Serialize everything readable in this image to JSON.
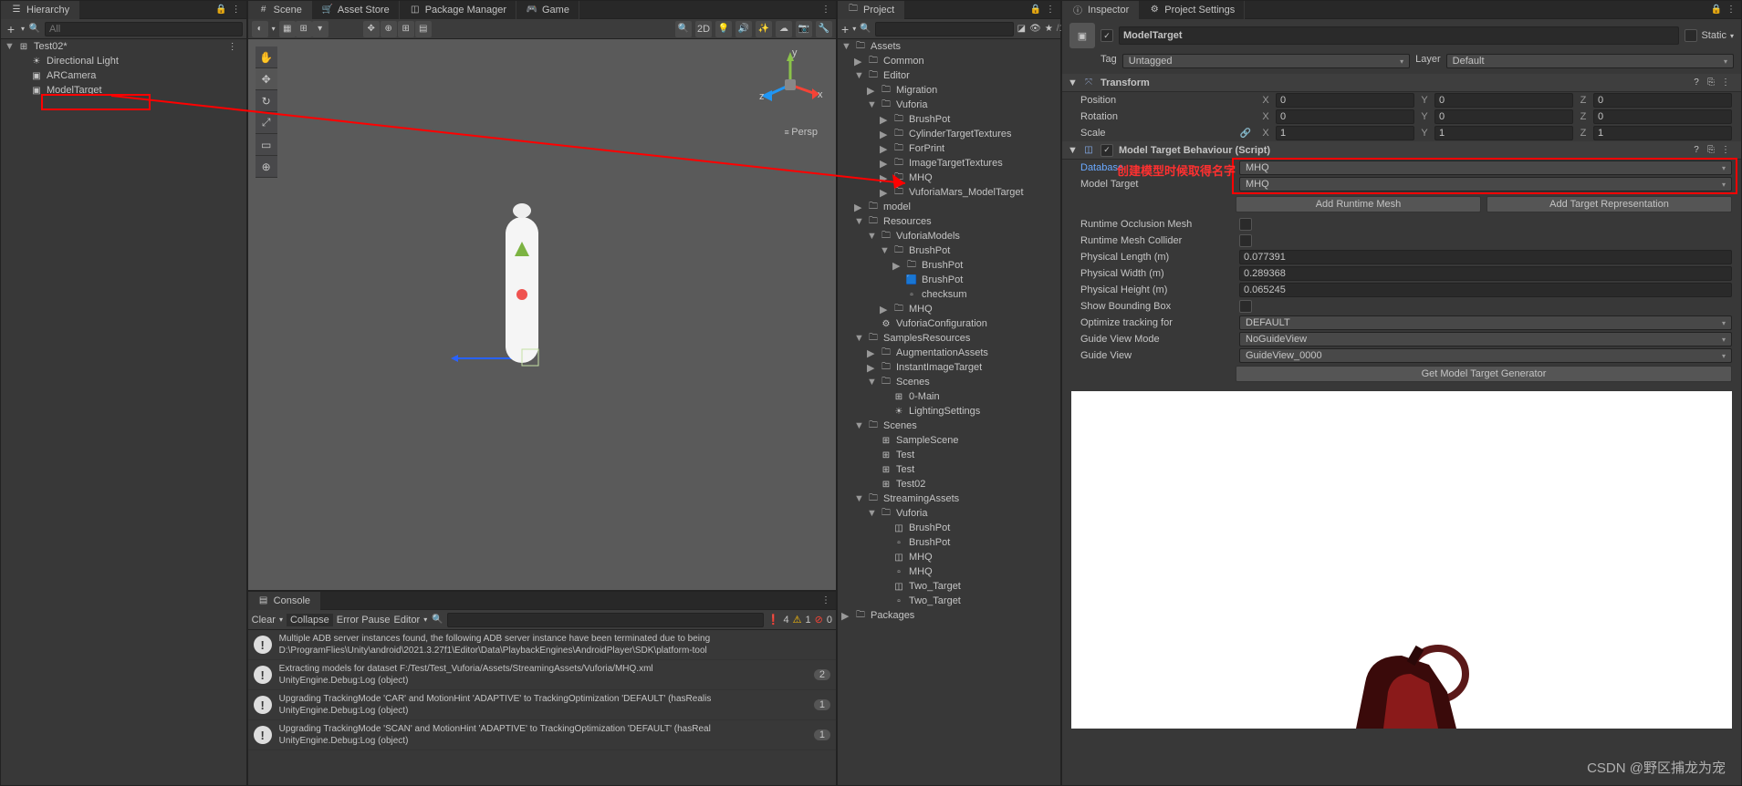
{
  "watermark": "CSDN @野区捕龙为宠",
  "hierarchy": {
    "tab": "Hierarchy",
    "searchPlaceholder": "All",
    "scene": "Test02*",
    "items": [
      "Directional Light",
      "ARCamera",
      "ModelTarget"
    ]
  },
  "sceneTabs": [
    "Scene",
    "Asset Store",
    "Package Manager",
    "Game"
  ],
  "sceneOverlay": {
    "persp": "Persp",
    "shading": "2D"
  },
  "console": {
    "tab": "Console",
    "buttons": {
      "clear": "Clear",
      "collapse": "Collapse",
      "errorPause": "Error Pause",
      "editor": "Editor"
    },
    "counts": {
      "info": "4",
      "warn": "1",
      "err": "0"
    },
    "entries": [
      {
        "type": "info",
        "count": "",
        "l1": "Multiple ADB server instances found, the following ADB server instance have been terminated due to being",
        "l2": "D:\\ProgramFlies\\Unity\\android\\2021.3.27f1\\Editor\\Data\\PlaybackEngines\\AndroidPlayer\\SDK\\platform-tool"
      },
      {
        "type": "info",
        "count": "2",
        "l1": "Extracting models for dataset F:/Test/Test_Vuforia/Assets/StreamingAssets/Vuforia/MHQ.xml",
        "l2": "UnityEngine.Debug:Log (object)"
      },
      {
        "type": "info",
        "count": "1",
        "l1": "Upgrading TrackingMode 'CAR' and MotionHint 'ADAPTIVE' to TrackingOptimization 'DEFAULT' (hasRealis",
        "l2": "UnityEngine.Debug:Log (object)"
      },
      {
        "type": "info",
        "count": "1",
        "l1": "Upgrading TrackingMode 'SCAN' and MotionHint 'ADAPTIVE' to TrackingOptimization 'DEFAULT' (hasReal",
        "l2": "UnityEngine.Debug:Log (object)"
      }
    ]
  },
  "project": {
    "tab": "Project",
    "tree": [
      {
        "d": 0,
        "a": "▼",
        "i": "folder",
        "t": "Assets"
      },
      {
        "d": 1,
        "a": "▶",
        "i": "folder",
        "t": "Common"
      },
      {
        "d": 1,
        "a": "▼",
        "i": "folder",
        "t": "Editor"
      },
      {
        "d": 2,
        "a": "▶",
        "i": "folder",
        "t": "Migration"
      },
      {
        "d": 2,
        "a": "▼",
        "i": "folder",
        "t": "Vuforia"
      },
      {
        "d": 3,
        "a": "▶",
        "i": "folder",
        "t": "BrushPot"
      },
      {
        "d": 3,
        "a": "▶",
        "i": "folder",
        "t": "CylinderTargetTextures"
      },
      {
        "d": 3,
        "a": "▶",
        "i": "folder",
        "t": "ForPrint"
      },
      {
        "d": 3,
        "a": "▶",
        "i": "folder",
        "t": "ImageTargetTextures"
      },
      {
        "d": 3,
        "a": "▶",
        "i": "folder",
        "t": "MHQ"
      },
      {
        "d": 3,
        "a": "▶",
        "i": "folder",
        "t": "VuforiaMars_ModelTarget"
      },
      {
        "d": 1,
        "a": "▶",
        "i": "folder",
        "t": "model"
      },
      {
        "d": 1,
        "a": "▼",
        "i": "folder",
        "t": "Resources"
      },
      {
        "d": 2,
        "a": "▼",
        "i": "folder",
        "t": "VuforiaModels"
      },
      {
        "d": 3,
        "a": "▼",
        "i": "folder",
        "t": "BrushPot"
      },
      {
        "d": 4,
        "a": "▶",
        "i": "folder",
        "t": "BrushPot"
      },
      {
        "d": 4,
        "a": "",
        "i": "prefab",
        "t": "BrushPot"
      },
      {
        "d": 4,
        "a": "",
        "i": "file",
        "t": "checksum"
      },
      {
        "d": 3,
        "a": "▶",
        "i": "folder",
        "t": "MHQ"
      },
      {
        "d": 2,
        "a": "",
        "i": "asset",
        "t": "VuforiaConfiguration"
      },
      {
        "d": 1,
        "a": "▼",
        "i": "folder",
        "t": "SamplesResources"
      },
      {
        "d": 2,
        "a": "▶",
        "i": "folder",
        "t": "AugmentationAssets"
      },
      {
        "d": 2,
        "a": "▶",
        "i": "folder",
        "t": "InstantImageTarget"
      },
      {
        "d": 2,
        "a": "▼",
        "i": "folder",
        "t": "Scenes"
      },
      {
        "d": 3,
        "a": "",
        "i": "scene",
        "t": "0-Main"
      },
      {
        "d": 3,
        "a": "",
        "i": "light",
        "t": "LightingSettings"
      },
      {
        "d": 1,
        "a": "▼",
        "i": "folder",
        "t": "Scenes"
      },
      {
        "d": 2,
        "a": "",
        "i": "scene",
        "t": "SampleScene"
      },
      {
        "d": 2,
        "a": "",
        "i": "scene",
        "t": "Test"
      },
      {
        "d": 2,
        "a": "",
        "i": "scene",
        "t": "Test"
      },
      {
        "d": 2,
        "a": "",
        "i": "scene",
        "t": "Test02"
      },
      {
        "d": 1,
        "a": "▼",
        "i": "folder",
        "t": "StreamingAssets"
      },
      {
        "d": 2,
        "a": "▼",
        "i": "folder",
        "t": "Vuforia"
      },
      {
        "d": 3,
        "a": "",
        "i": "vuf",
        "t": "BrushPot"
      },
      {
        "d": 3,
        "a": "",
        "i": "file",
        "t": "BrushPot"
      },
      {
        "d": 3,
        "a": "",
        "i": "vuf",
        "t": "MHQ"
      },
      {
        "d": 3,
        "a": "",
        "i": "file",
        "t": "MHQ"
      },
      {
        "d": 3,
        "a": "",
        "i": "vuf",
        "t": "Two_Target"
      },
      {
        "d": 3,
        "a": "",
        "i": "file",
        "t": "Two_Target"
      },
      {
        "d": 0,
        "a": "▶",
        "i": "folder",
        "t": "Packages"
      }
    ]
  },
  "inspector": {
    "tabs": [
      "Inspector",
      "Project Settings"
    ],
    "name": "ModelTarget",
    "static": "Static",
    "tagLabel": "Tag",
    "tagValue": "Untagged",
    "layerLabel": "Layer",
    "layerValue": "Default",
    "transform": {
      "title": "Transform",
      "rows": [
        {
          "label": "Position",
          "x": "0",
          "y": "0",
          "z": "0"
        },
        {
          "label": "Rotation",
          "x": "0",
          "y": "0",
          "z": "0"
        },
        {
          "label": "Scale",
          "x": "1",
          "y": "1",
          "z": "1"
        }
      ]
    },
    "mtb": {
      "title": "Model Target Behaviour (Script)",
      "annotation": "创建模型时候取得名字",
      "databaseLabel": "Database",
      "databaseValue": "MHQ",
      "modelTargetLabel": "Model Target",
      "modelTargetValue": "MHQ",
      "addRuntime": "Add Runtime Mesh",
      "addTarget": "Add Target Representation",
      "props": [
        {
          "label": "Runtime Occlusion Mesh",
          "type": "check",
          "value": false
        },
        {
          "label": "Runtime Mesh Collider",
          "type": "check",
          "value": false
        },
        {
          "label": "Physical Length (m)",
          "type": "text",
          "value": "0.077391"
        },
        {
          "label": "Physical Width (m)",
          "type": "text",
          "value": "0.289368"
        },
        {
          "label": "Physical Height (m)",
          "type": "text",
          "value": "0.065245"
        },
        {
          "label": "Show Bounding Box",
          "type": "check",
          "value": false
        },
        {
          "label": "Optimize tracking for",
          "type": "dd",
          "value": "DEFAULT"
        },
        {
          "label": "Guide View Mode",
          "type": "dd",
          "value": "NoGuideView"
        },
        {
          "label": "Guide View",
          "type": "dd",
          "value": "GuideView_0000"
        }
      ],
      "getGenerator": "Get Model Target Generator"
    }
  }
}
